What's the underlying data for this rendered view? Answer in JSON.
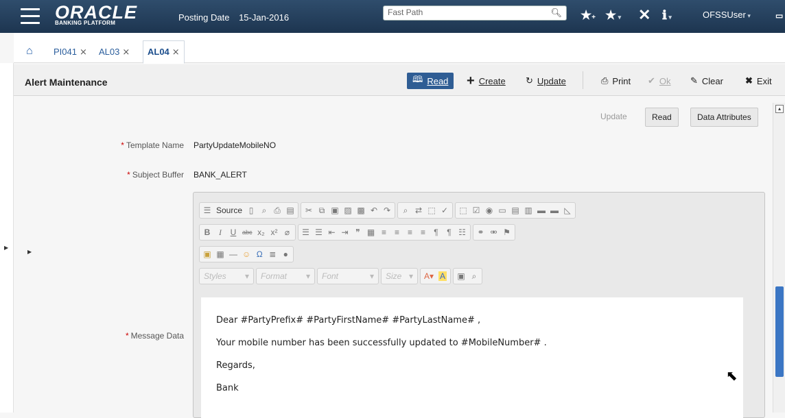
{
  "topbar": {
    "logo_text": "ORACLE",
    "logo_sub": "BANKING PLATFORM",
    "posting_label": "Posting Date",
    "posting_date": "15-Jan-2016",
    "fastpath_placeholder": "Fast Path",
    "user": "OFSSUser"
  },
  "tabs": [
    {
      "label": "PI041"
    },
    {
      "label": "AL03"
    },
    {
      "label": "AL04"
    }
  ],
  "header": {
    "title": "Alert Maintenance",
    "read": "Read",
    "create": "Create",
    "update": "Update",
    "print": "Print",
    "ok": "Ok",
    "clear": "Clear",
    "exit": "Exit"
  },
  "subactions": {
    "update": "Update",
    "read": "Read",
    "data_attributes": "Data Attributes"
  },
  "form": {
    "template_label": "Template Name",
    "template_value": "PartyUpdateMobileNO",
    "subject_label": "Subject Buffer",
    "subject_value": "BANK_ALERT",
    "message_label": "Message Data"
  },
  "editor": {
    "source_label": "Source",
    "styles": "Styles",
    "format": "Format",
    "font": "Font",
    "size": "Size",
    "lines": [
      "Dear #PartyPrefix# #PartyFirstName# #PartyLastName# ,",
      "Your mobile number has been successfully updated to #MobileNumber# .",
      "Regards,",
      "Bank"
    ]
  }
}
